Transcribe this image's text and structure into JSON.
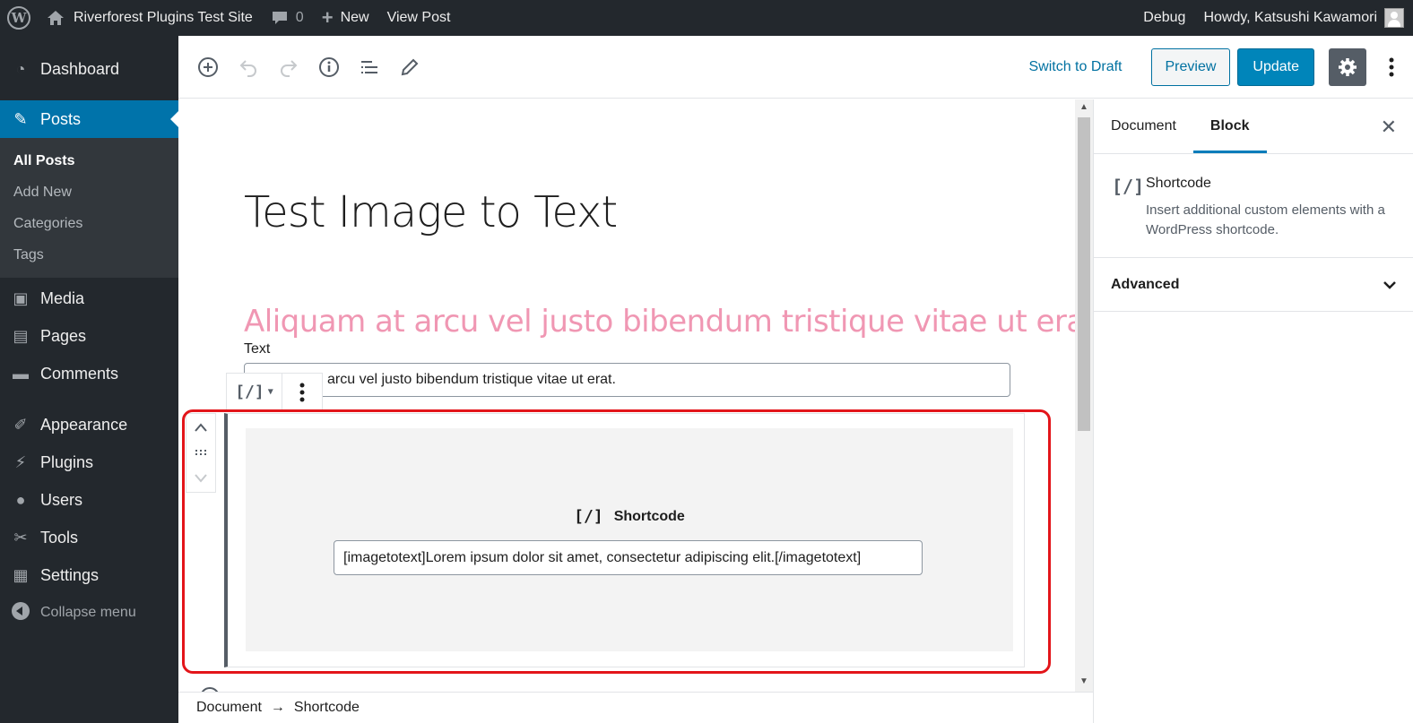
{
  "admin_bar": {
    "site_name": "Riverforest Plugins Test Site",
    "comments_count": "0",
    "new_label": "New",
    "view_post_label": "View Post",
    "debug_label": "Debug",
    "greeting": "Howdy, Katsushi Kawamori"
  },
  "sidebar": {
    "items": [
      {
        "label": "Dashboard",
        "icon": "dashboard-icon"
      },
      {
        "label": "Posts",
        "icon": "pin-icon"
      },
      {
        "label": "Media",
        "icon": "media-icon"
      },
      {
        "label": "Pages",
        "icon": "pages-icon"
      },
      {
        "label": "Comments",
        "icon": "comments-icon"
      },
      {
        "label": "Appearance",
        "icon": "appearance-icon"
      },
      {
        "label": "Plugins",
        "icon": "plugins-icon"
      },
      {
        "label": "Users",
        "icon": "users-icon"
      },
      {
        "label": "Tools",
        "icon": "tools-icon"
      },
      {
        "label": "Settings",
        "icon": "settings-icon"
      }
    ],
    "posts_submenu": [
      "All Posts",
      "Add New",
      "Categories",
      "Tags"
    ],
    "collapse_label": "Collapse menu"
  },
  "header": {
    "switch_to_draft": "Switch to Draft",
    "preview": "Preview",
    "update": "Update"
  },
  "editor": {
    "post_title": "Test Image to Text",
    "pink_heading": "Aliquam at arcu vel justo bibendum tristique vitae ut erat.",
    "text_label": "Text",
    "text_value": "arcu vel justo bibendum tristique vitae ut erat.",
    "block_type_icon": "[/]",
    "shortcode_label": "Shortcode",
    "shortcode_icon": "[/]",
    "shortcode_value": "[imagetotext]Lorem ipsum dolor sit amet, consectetur adipiscing elit.[/imagetotext]"
  },
  "settings_panel": {
    "tab_document": "Document",
    "tab_block": "Block",
    "block_icon": "[/]",
    "block_title": "Shortcode",
    "block_description": "Insert additional custom elements with a WordPress shortcode.",
    "advanced_label": "Advanced"
  },
  "breadcrumb": {
    "root": "Document",
    "separator": "→",
    "current": "Shortcode"
  },
  "colors": {
    "admin_bg": "#23282d",
    "accent": "#0073aa",
    "heading_pink": "#f097b3",
    "highlight_red": "#e3151a"
  }
}
